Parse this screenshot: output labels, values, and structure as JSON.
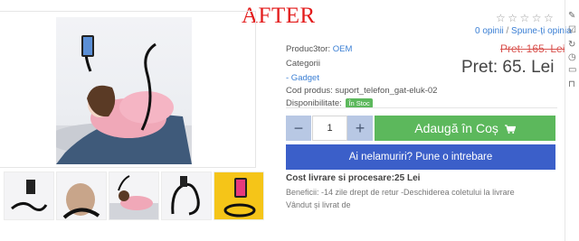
{
  "banner": {
    "text": "AFTER"
  },
  "rating": {
    "stars": "☆☆☆☆☆",
    "opinions": "0 opinii",
    "separator": " / ",
    "write_link": "Spune-ți opinia"
  },
  "product": {
    "producer_label": "Produc3tor:",
    "producer_value": "OEM",
    "category_label": "Categorii",
    "category_value": "- Gadget",
    "code_label": "Cod produs:",
    "code_value": "suport_telefon_gat-eluk-02",
    "availability_label": "Disponibilitate:",
    "availability_value": "În Stoc",
    "old_price": "Pret: 165. Lei",
    "price": "Pret: 65. Lei"
  },
  "quantity": {
    "minus": "−",
    "value": "1",
    "plus": "+"
  },
  "actions": {
    "add_to_cart": "Adaugă în Coș",
    "cart_icon": "cart-icon",
    "ask_question": "Ai nelamuriri? Pune o intrebare"
  },
  "shipping": "Cost livrare si procesare:25 Lei",
  "benefits": "Beneficii: -14 zile drept de retur -Deschiderea coletului la livrare",
  "sold_by": "Vândut și livrat de",
  "colors": {
    "banner": "#e31c1c",
    "link": "#3b7fd4",
    "add_button": "#5cb85c",
    "ask_button": "#3b5fc9",
    "old_price": "#d9534f",
    "stock_badge": "#5cb85c"
  }
}
